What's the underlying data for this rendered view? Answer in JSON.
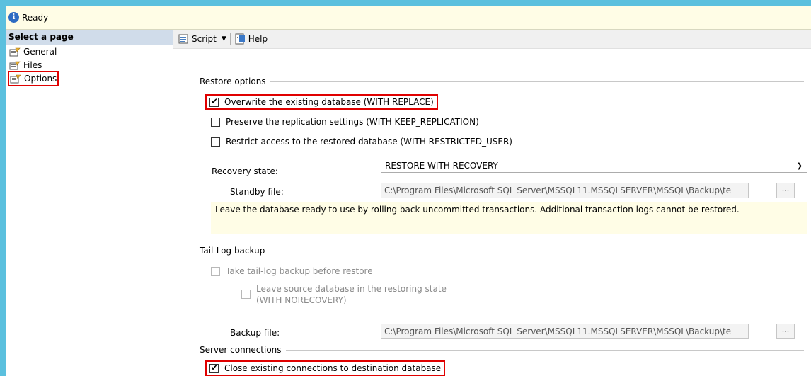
{
  "status": {
    "text": "Ready"
  },
  "left_pane": {
    "header": "Select a page",
    "items": [
      {
        "label": "General"
      },
      {
        "label": "Files"
      },
      {
        "label": "Options"
      }
    ]
  },
  "toolbar": {
    "script_label": "Script",
    "help_label": "Help"
  },
  "restore_options": {
    "title": "Restore options",
    "overwrite": "Overwrite the existing database (WITH REPLACE)",
    "preserve": "Preserve the replication settings (WITH KEEP_REPLICATION)",
    "restrict": "Restrict access to the restored database (WITH RESTRICTED_USER)",
    "recovery_state_label": "Recovery state:",
    "recovery_state_value": "RESTORE WITH RECOVERY",
    "standby_label": "Standby file:",
    "standby_value": "C:\\Program Files\\Microsoft SQL Server\\MSSQL11.MSSQLSERVER\\MSSQL\\Backup\\te",
    "browse_label": "...",
    "note": "Leave the database ready to use by rolling back uncommitted transactions. Additional transaction logs cannot be restored."
  },
  "tail_log": {
    "title": "Tail-Log backup",
    "take_tail": "Take tail-log backup before restore",
    "leave_source_line1": "Leave source database in the restoring state",
    "leave_source_line2": "(WITH NORECOVERY)",
    "backup_file_label": "Backup file:",
    "backup_file_value": "C:\\Program Files\\Microsoft SQL Server\\MSSQL11.MSSQLSERVER\\MSSQL\\Backup\\te",
    "browse_label": "..."
  },
  "server_connections": {
    "title": "Server connections",
    "close_existing": "Close existing connections to destination database"
  }
}
